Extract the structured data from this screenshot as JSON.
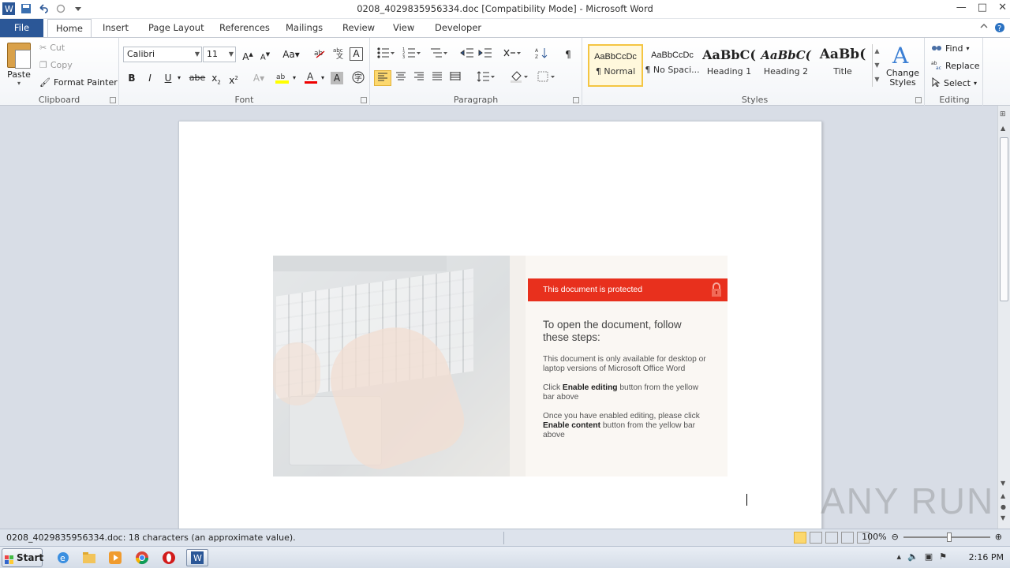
{
  "window": {
    "title": "0208_4029835956334.doc [Compatibility Mode]  -  Microsoft Word",
    "controls": [
      "—",
      "□",
      "✕"
    ]
  },
  "tabs": [
    "File",
    "Home",
    "Insert",
    "Page Layout",
    "References",
    "Mailings",
    "Review",
    "View",
    "Developer"
  ],
  "active_tab": "Home",
  "clipboard": {
    "paste": "Paste",
    "cut": "Cut",
    "copy": "Copy",
    "format_painter": "Format Painter",
    "label": "Clipboard"
  },
  "font": {
    "name": "Calibri",
    "size": "11",
    "label": "Font"
  },
  "paragraph": {
    "label": "Paragraph"
  },
  "styles": {
    "label": "Styles",
    "items": [
      {
        "sample": "AaBbCcDc",
        "name": "¶ Normal"
      },
      {
        "sample": "AaBbCcDc",
        "name": "¶ No Spaci..."
      },
      {
        "sample": "AaBbC(",
        "name": "Heading 1"
      },
      {
        "sample": "AaBbC(",
        "name": "Heading 2"
      },
      {
        "sample": "AaBb(",
        "name": "Title"
      }
    ],
    "change_styles": "Change Styles"
  },
  "editing": {
    "label": "Editing",
    "find": "Find",
    "replace": "Replace",
    "select": "Select"
  },
  "document": {
    "banner": "This document is protected",
    "heading": "To open the document, follow these steps:",
    "p1": "This document is only available for desktop or laptop versions of Microsoft Office Word",
    "p2_pre": "Click ",
    "p2_bold": "Enable editing",
    "p2_post": " button from the yellow bar above",
    "p3_pre": "Once you have enabled editing, please click ",
    "p3_bold": "Enable content",
    "p3_post": " button from the yellow bar above"
  },
  "status": {
    "text": "0208_4029835956334.doc: 18 characters (an approximate value).",
    "zoom": "100%"
  },
  "taskbar": {
    "start": "Start",
    "time": "2:16 PM"
  },
  "watermark": "ANY RUN",
  "colors": {
    "file_tab": "#2b5797",
    "banner_red": "#e8301d",
    "selected_style": "#f4c542"
  }
}
